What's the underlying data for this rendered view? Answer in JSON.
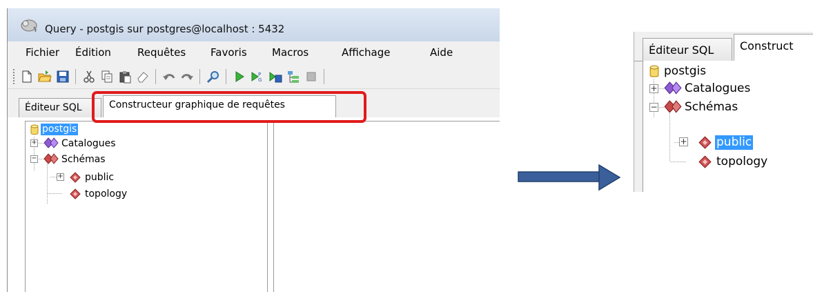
{
  "window": {
    "title": "Query - postgis sur postgres@localhost : 5432"
  },
  "menu": [
    "Fichier",
    "Édition",
    "Requêtes",
    "Favoris",
    "Macros",
    "Affichage",
    "Aide"
  ],
  "toolbar": {
    "icons": [
      "new-icon",
      "open-folder-icon",
      "save-icon",
      "cut-icon",
      "copy-icon",
      "paste-icon",
      "eraser-icon",
      "undo-icon",
      "redo-icon",
      "find-icon",
      "run-icon",
      "run-pgsql-icon",
      "run-to-file-icon",
      "explain-icon",
      "stop-icon"
    ]
  },
  "tabs": {
    "sql_editor": "Éditeur SQL",
    "query_builder": "Constructeur graphique de requêtes"
  },
  "tree": {
    "root": "postgis",
    "catalogues": "Catalogues",
    "schemas": "Schémas",
    "public": "public",
    "topology": "topology"
  },
  "zoom": {
    "tab_sql": "Éditeur SQL",
    "tab_builder": "Construct",
    "root": "postgis",
    "catalogues": "Catalogues",
    "schemas": "Schémas",
    "public": "public",
    "topology": "topology"
  },
  "colors": {
    "highlight": "#e11b1b",
    "arrow": "#3a5f9a",
    "selection": "#3399ff"
  }
}
